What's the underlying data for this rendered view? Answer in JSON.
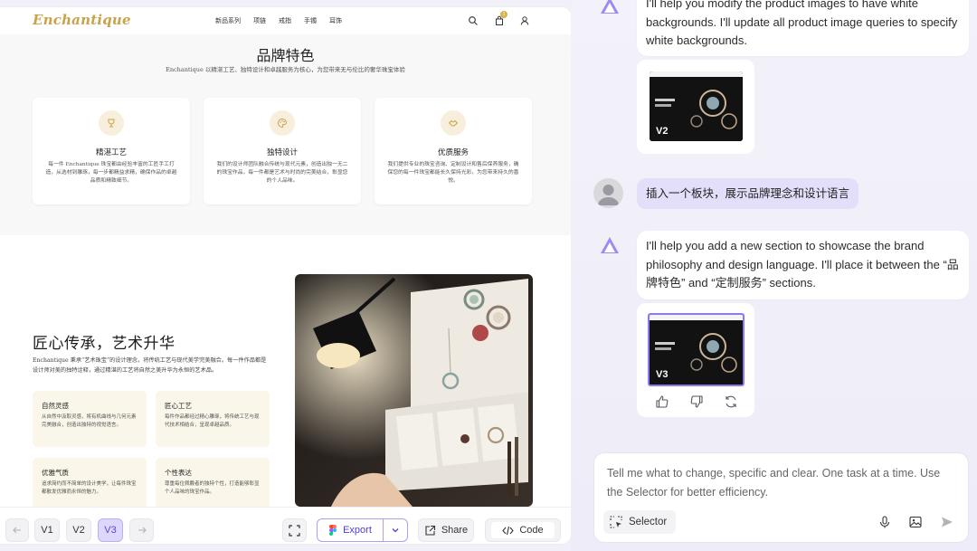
{
  "preview": {
    "site": {
      "logo": "Enchantique",
      "nav_links": [
        "新品系列",
        "项链",
        "戒指",
        "手镯",
        "耳饰"
      ],
      "cart_count": "1"
    },
    "brand_section": {
      "title": "品牌特色",
      "subtitle": "Enchantique 以精湛工艺、独特设计和卓越服务为核心，为您带来无与伦比的奢华珠宝体验",
      "features": [
        {
          "title": "精湛工艺",
          "icon": "trophy-icon",
          "desc": "每一件 Enchantique 珠宝都由经验丰富的工匠手工打造，从选材到雕琢，每一步都精益求精，确保作品的卓越品质和精致细节。"
        },
        {
          "title": "独特设计",
          "icon": "palette-icon",
          "desc": "我们的设计师团队融合传统与现代元素，创造出独一无二的珠宝作品，每一件都是艺术与时尚的完美结合，彰显您的个人品味。"
        },
        {
          "title": "优质服务",
          "icon": "handshake-icon",
          "desc": "我们提供专业的珠宝咨询、定制设计和售后保养服务，确保您的每一件珠宝都能长久保持光彩，为您带来持久的喜悦。"
        }
      ]
    },
    "craft_section": {
      "title": "匠心传承，艺术升华",
      "desc": "Enchantique 秉承“艺术珠宝”的设计理念，将传统工艺与现代美学完美融合。每一件作品都是设计师对美的独特诠释，通过精湛的工艺将自然之美升华为永恒的艺术品。",
      "cards": [
        {
          "title": "自然灵感",
          "desc": "从自然中汲取灵感，将有机曲线与几何元素完美融合，创造出独特的视觉语言。"
        },
        {
          "title": "匠心工艺",
          "desc": "每件作品都经过精心雕琢，将传统工艺与现代技术相结合，呈现卓越品质。"
        },
        {
          "title": "优雅气质",
          "desc": "追求简约而不简单的设计美学，让每件珠宝都散发优雅而永恒的魅力。"
        },
        {
          "title": "个性表达",
          "desc": "尊重每位佩戴者的独特个性，打造能够彰显个人品味的珠宝作品。"
        }
      ]
    },
    "toolbar": {
      "versions": [
        "V1",
        "V2",
        "V3"
      ],
      "export": "Export",
      "share": "Share",
      "code": "Code"
    }
  },
  "chat": {
    "msg1": "I'll help you modify the product images to have white backgrounds. I'll update all product image queries to specify white backgrounds.",
    "thumb1_label": "V2",
    "user_msg": "插入一个板块，展示品牌理念和设计语言",
    "msg2": "I'll help you add a new section to showcase the brand philosophy and design language. I'll place it between the “品牌特色” and “定制服务” sections.",
    "thumb2_label": "V3",
    "composer_placeholder": "Tell me what to change, specific and clear. One task at a time. Use the Selector for better efficiency.",
    "selector_label": "Selector"
  },
  "colors": {
    "accent": "#5a47d6",
    "gold": "#c9a24a",
    "chat_bg": "#f1f0f8"
  }
}
